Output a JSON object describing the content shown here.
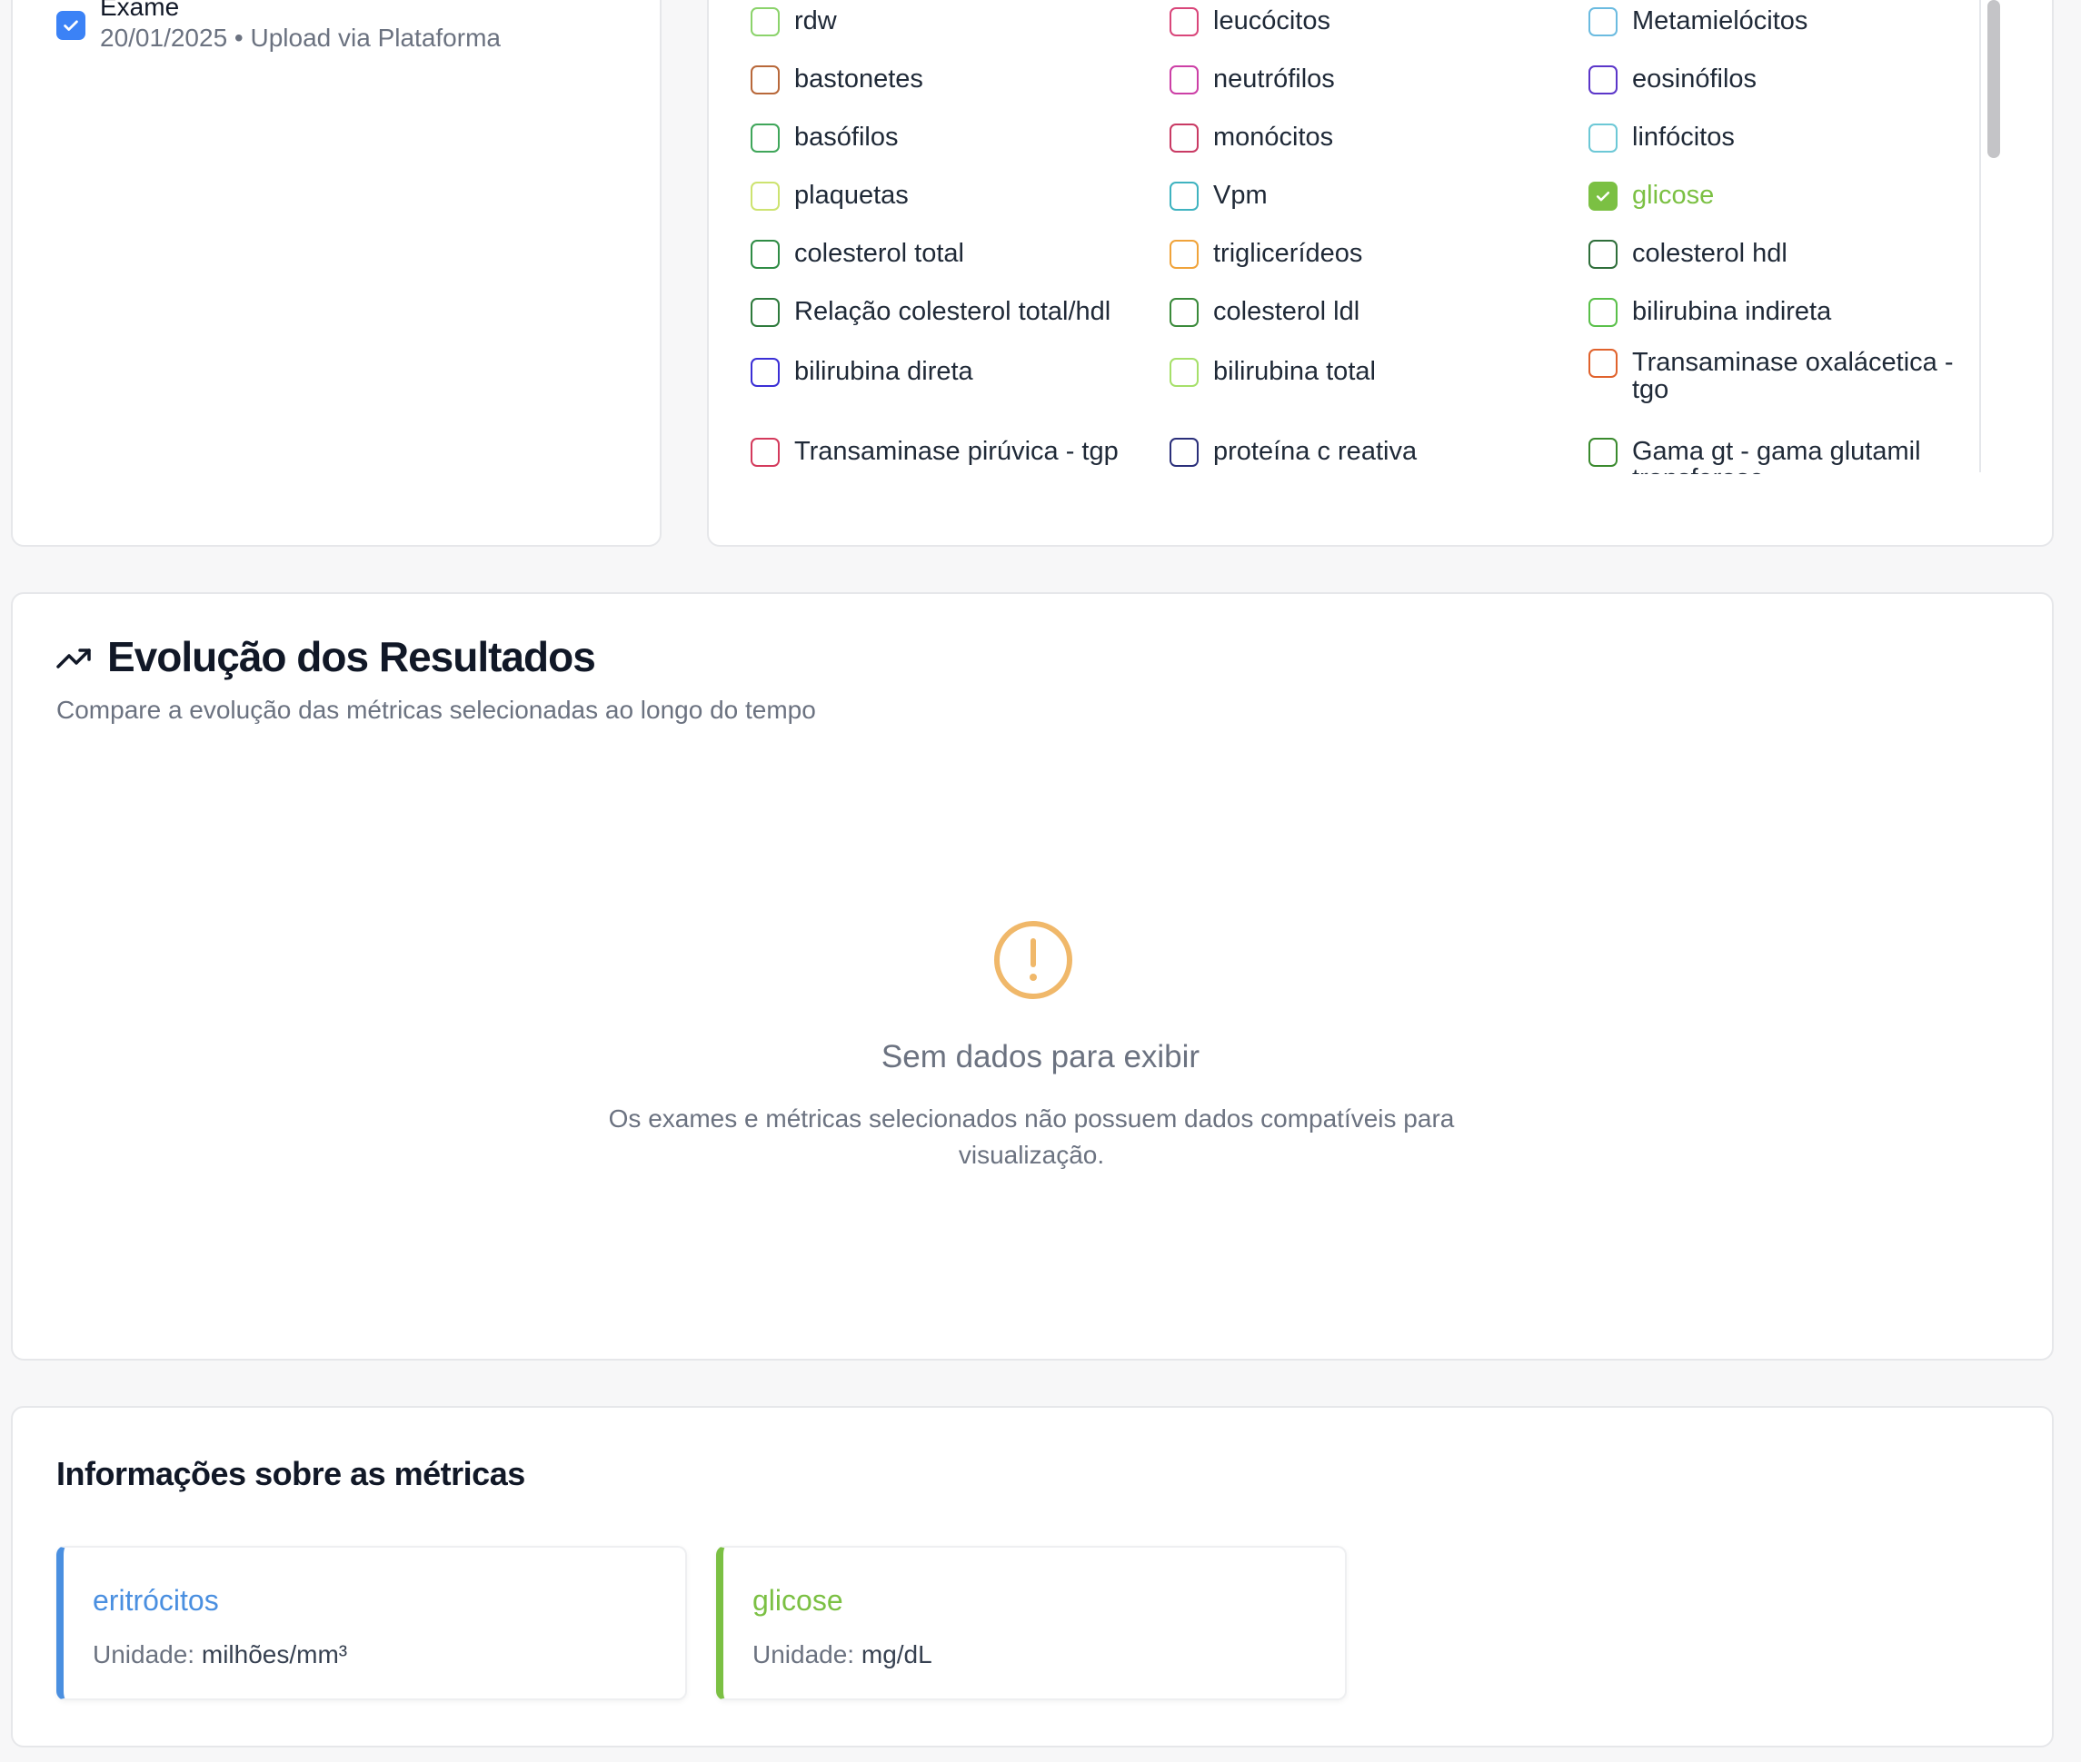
{
  "exam": {
    "title": "Exame",
    "meta": "20/01/2025 • Upload via Plataforma",
    "checked": true
  },
  "metrics": [
    {
      "label": "rdw",
      "color": "#8bd36b",
      "checked": false
    },
    {
      "label": "leucócitos",
      "color": "#d9467a",
      "checked": false
    },
    {
      "label": "Metamielócitos",
      "color": "#6bbbe0",
      "checked": false
    },
    {
      "label": "bastonetes",
      "color": "#b8683a",
      "checked": false
    },
    {
      "label": "neutrófilos",
      "color": "#cc3fa6",
      "checked": false
    },
    {
      "label": "eosinófilos",
      "color": "#5b36c9",
      "checked": false
    },
    {
      "label": "basófilos",
      "color": "#3fa65a",
      "checked": false
    },
    {
      "label": "monócitos",
      "color": "#c93a64",
      "checked": false
    },
    {
      "label": "linfócitos",
      "color": "#6cc8d6",
      "checked": false
    },
    {
      "label": "plaquetas",
      "color": "#cde370",
      "checked": false
    },
    {
      "label": "Vpm",
      "color": "#3fb3c0",
      "checked": false
    },
    {
      "label": "glicose",
      "color": "#7bc043",
      "checked": true
    },
    {
      "label": "colesterol total",
      "color": "#2f8c45",
      "checked": false
    },
    {
      "label": "triglicerídeos",
      "color": "#f0a33a",
      "checked": false
    },
    {
      "label": "colesterol hdl",
      "color": "#2e6e3a",
      "checked": false
    },
    {
      "label": "Relação colesterol total/hdl",
      "color": "#2e7a3c",
      "checked": false
    },
    {
      "label": "colesterol ldl",
      "color": "#3a8a3a",
      "checked": false
    },
    {
      "label": "bilirubina indireta",
      "color": "#5ac04a",
      "checked": false
    },
    {
      "label": "bilirubina direta",
      "color": "#3b2fd6",
      "checked": false
    },
    {
      "label": "bilirubina total",
      "color": "#a6e06a",
      "checked": false
    },
    {
      "label": "Transaminase oxalácetica - tgo",
      "color": "#e0622c",
      "checked": false
    },
    {
      "label": "Transaminase pirúvica - tgp",
      "color": "#d43a5c",
      "checked": false
    },
    {
      "label": "proteína c reativa",
      "color": "#2a2f7a",
      "checked": false
    },
    {
      "label": "Gama gt - gama glutamil transferase",
      "color": "#3a8a2e",
      "checked": false
    }
  ],
  "chart_section": {
    "title": "Evolução dos Resultados",
    "subtitle": "Compare a evolução das métricas selecionadas ao longo do tempo",
    "empty_title": "Sem dados para exibir",
    "empty_desc": "Os exames e métricas selecionados não possuem dados compatíveis para visualização.",
    "trend_icon": "trending-up-icon",
    "alert_icon": "alert-circle-icon",
    "alert_color": "#f0b86a"
  },
  "info_section": {
    "title": "Informações sobre as métricas",
    "unit_label": "Unidade:",
    "items": [
      {
        "name": "eritrócitos",
        "unit": "milhões/mm³",
        "color": "#4a8fe0"
      },
      {
        "name": "glicose",
        "unit": "mg/dL",
        "color": "#7bc043"
      }
    ]
  }
}
